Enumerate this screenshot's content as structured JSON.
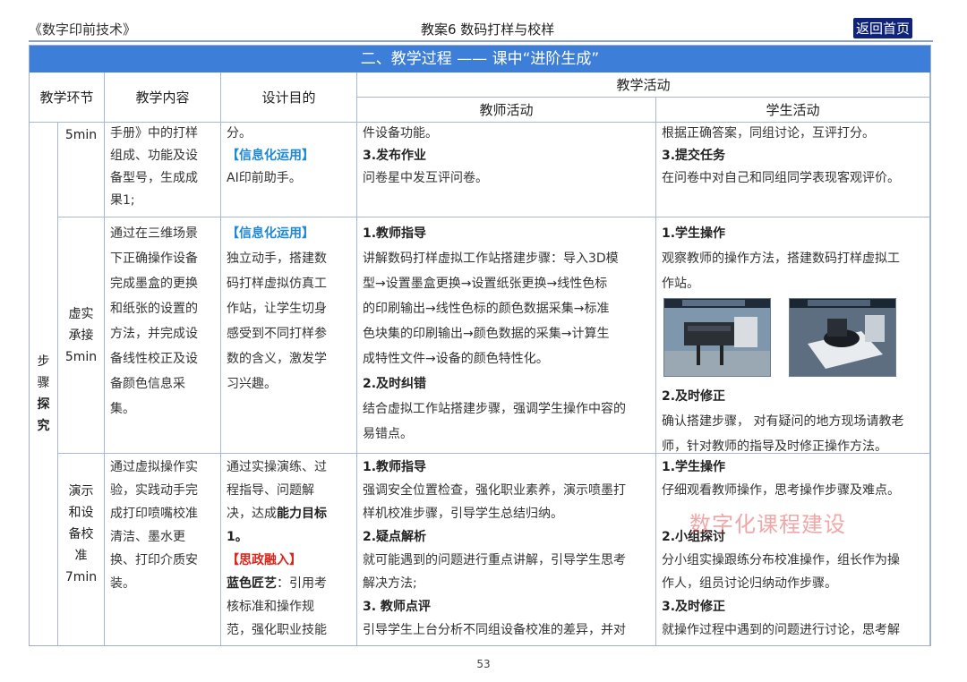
{
  "header": {
    "book_title": "《数字印前技术》",
    "lesson_title": "教案6 数码打样与校样",
    "home_button": "返回首页"
  },
  "banner": "二、教学过程 —— 课中“进阶生成”",
  "columns": {
    "stage": "教学环节",
    "content": "教学内容",
    "purpose": "设计目的",
    "activity": "教学活动",
    "teacher": "教师活动",
    "student": "学生活动"
  },
  "row1": {
    "time": "5min",
    "content": [
      "手册》中的打样",
      "组成、功能及设",
      "备型号，生成成",
      "果1;"
    ],
    "purpose_1": "分。",
    "purpose_tag": "【信息化运用】",
    "purpose_2": "AI印前助手。",
    "teacher_1": "件设备功能。",
    "teacher_h": "3.发布作业",
    "teacher_2": "问卷星中发互评问卷。",
    "student_1": "根据正确答案，同组讨论，互评打分。",
    "student_h": "3.提交任务",
    "student_2": "在问卷中对自己和同组同学表现客观评价。"
  },
  "stage_side": [
    "步",
    "骤",
    "探",
    "究"
  ],
  "row2": {
    "stage": [
      "虚实",
      "承接",
      "5min"
    ],
    "content": [
      "通过在三维场景",
      "下正确操作设备",
      "完成墨盒的更换",
      "和纸张的设置的",
      "方法，并完成设",
      "备线性校正及设",
      "备颜色信息采",
      "集。"
    ],
    "purpose_tag": "【信息化运用】",
    "purpose": [
      "独立动手，搭建数",
      "码打样虚拟仿真工",
      "作站，让学生切身",
      "感受到不同打样参",
      "数的含义，激发学",
      "习兴趣。"
    ],
    "teacher_h1": "1.教师指导",
    "teacher_1": [
      "讲解数码打样虚拟工作站搭建步骤：导入3D模",
      "型→设置墨盒更换→设置纸张更换→线性色标",
      "的印刷输出→线性色标的颜色数据采集→标准",
      "色块集的印刷输出→颜色数据的采集→计算生",
      "成特性文件→设备的颜色特性化。"
    ],
    "teacher_h2": "2.及时纠错",
    "teacher_2": [
      "结合虚拟工作站搭建步骤，强调学生操作中容的",
      "易错点。"
    ],
    "student_h1": "1.学生操作",
    "student_1": [
      "观察教师的操作方法，搭建数码打样虚拟工",
      "作站。"
    ],
    "student_h2": "2.及时修正",
    "student_2": [
      "确认搭建步骤， 对有疑问的地方现场请教老",
      "师，针对教师的指导及时修正操作方法。"
    ]
  },
  "row3": {
    "stage": [
      "演示",
      "和设",
      "备校",
      "准",
      "7min"
    ],
    "content": [
      "通过虚拟操作实",
      "验，实践动手完",
      "成打印喷嘴校准",
      "清洁、墨水更",
      "换、打印介质安",
      "装。"
    ],
    "purpose_a": "通过实操演练、过",
    "purpose_b": "程指导、问题解",
    "purpose_c_pre": "决，达成",
    "purpose_c_bold": "能力目标",
    "purpose_d": "1。",
    "purpose_tag": "【思政融入】",
    "purpose_e_bold": "蓝色匠艺",
    "purpose_e": "：引用考",
    "purpose_f": "核标准和操作规",
    "purpose_g": "范，强化职业技能",
    "teacher_h1": "1.教师指导",
    "teacher_1": [
      "强调安全位置检查，强化职业素养，演示喷墨打",
      "样机校准步骤，引导学生总结归纳。"
    ],
    "teacher_h2": "2.疑点解析",
    "teacher_2": [
      "就可能遇到的问题进行重点讲解，引导学生思考",
      "解决方法;"
    ],
    "teacher_h3": "3. 教师点评",
    "teacher_3": "引导学生上台分析不同组设备校准的差异，并对",
    "student_h1": "1.学生操作",
    "student_1": "仔细观看教师操作，思考操作步骤及难点。",
    "student_h2": "2.小组探讨",
    "student_2": [
      "分小组实操跟练分布校准操作，组长作为操",
      "作人，组员讨论归纳动作步骤。"
    ],
    "student_h3": "3.及时修正",
    "student_3": "就操作过程中遇到的问题进行讨论，思考解"
  },
  "watermark": "数字化课程建设",
  "page_number": "53"
}
